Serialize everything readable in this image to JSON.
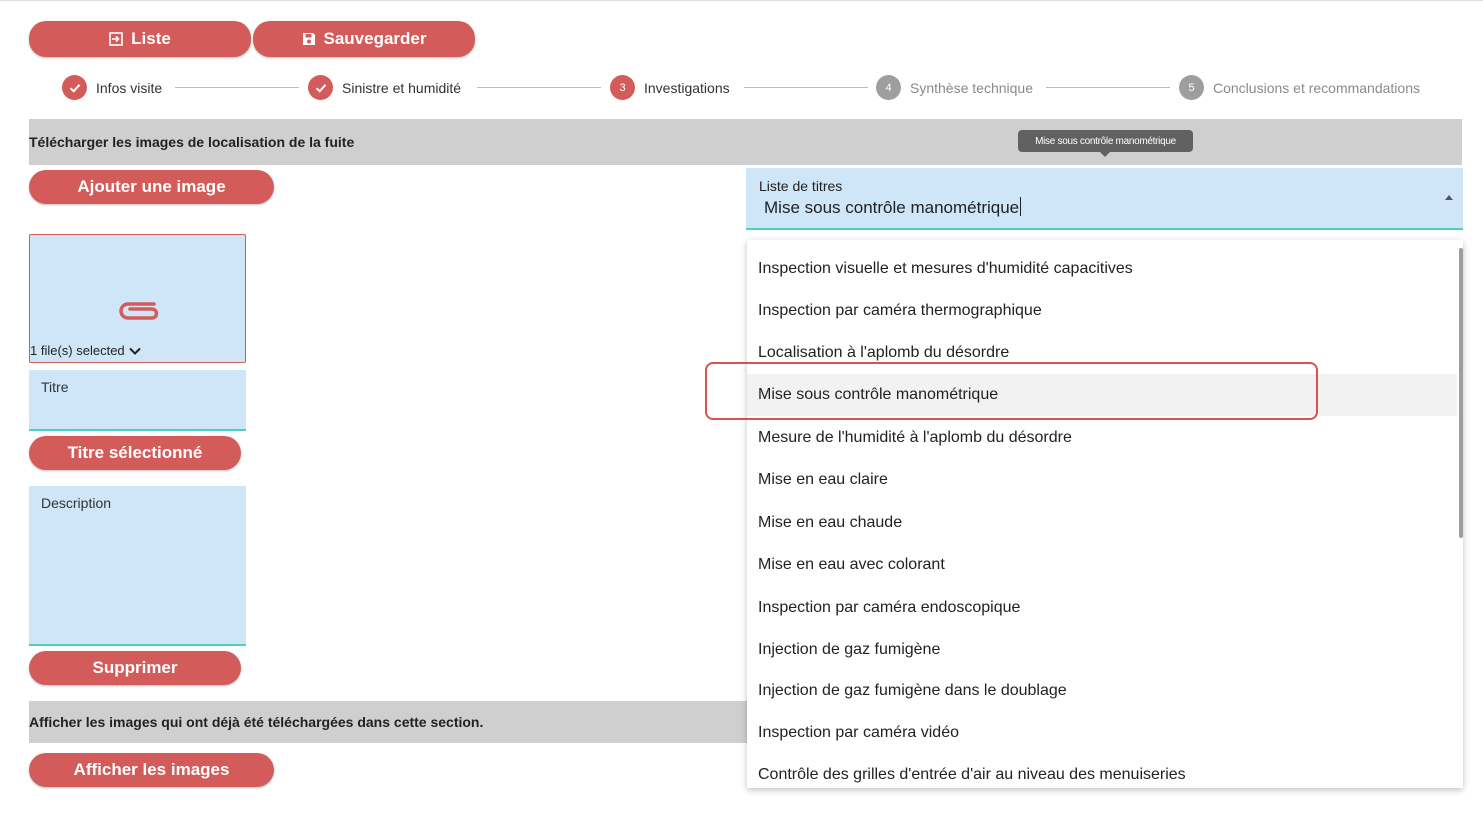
{
  "toolbar": {
    "list_label": "Liste",
    "save_label": "Sauvegarder"
  },
  "stepper": {
    "steps": [
      {
        "label": "Infos visite",
        "state": "done",
        "number": ""
      },
      {
        "label": "Sinistre et humidité",
        "state": "done",
        "number": ""
      },
      {
        "label": "Investigations",
        "state": "active",
        "number": "3"
      },
      {
        "label": "Synthèse technique",
        "state": "todo",
        "number": "4"
      },
      {
        "label": "Conclusions et recommandations",
        "state": "todo",
        "number": "5"
      }
    ]
  },
  "upload_section": {
    "heading": "Télécharger les images de localisation de la fuite",
    "add_image_label": "Ajouter une image",
    "files_selected": "1 file(s) selected",
    "title_field_label": "Titre",
    "selected_title_button": "Titre sélectionné",
    "description_field_label": "Description",
    "delete_button": "Supprimer"
  },
  "view_section": {
    "heading": "Afficher les images qui ont déjà été téléchargées dans cette section.",
    "show_images_button": "Afficher les images"
  },
  "title_select": {
    "label": "Liste de titres",
    "value": "Mise sous contrôle manométrique",
    "tooltip": "Mise sous contrôle manométrique",
    "options": [
      "Inspection visuelle et mesures d'humidité capacitives",
      "Inspection par caméra thermographique",
      "Localisation à l'aplomb du désordre",
      "Mise sous contrôle manométrique",
      "Mesure de l'humidité à l'aplomb du désordre",
      "Mise en eau claire",
      "Mise en eau chaude",
      "Mise en eau avec colorant",
      "Inspection par caméra endoscopique",
      "Injection de gaz fumigène",
      "Injection de gaz fumigène dans le doublage",
      "Inspection par caméra vidéo",
      "Contrôle des grilles d'entrée d'air au niveau des menuiseries"
    ],
    "highlighted_index": 3
  },
  "colors": {
    "accent": "#d35c5a",
    "field_bg": "#cfe5f8",
    "field_underline": "#4fd1b8",
    "section_bg": "#cfcfcf"
  }
}
